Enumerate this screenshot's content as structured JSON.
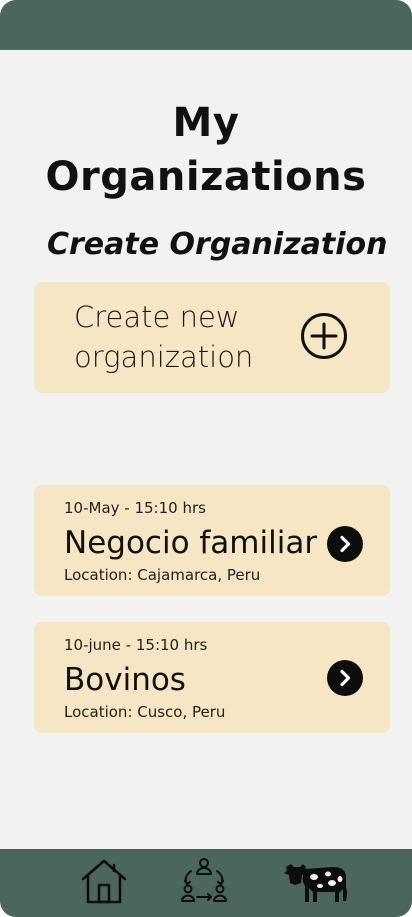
{
  "header": {
    "title_line1": "My",
    "title_line2": "Organizations"
  },
  "create_section": {
    "heading": "Create Organization",
    "card_label_line1": "Create new",
    "card_label_line2": "organization",
    "icon": "plus-circle-icon"
  },
  "organizations": [
    {
      "date": "10-May - 15:10 hrs",
      "name": "Negocio familiar",
      "location": "Location: Cajamarca, Peru",
      "icon": "chevron-right-circle-icon"
    },
    {
      "date": "10-june - 15:10 hrs",
      "name": "Bovinos",
      "location": "Location: Cusco, Peru",
      "icon": "chevron-right-circle-icon"
    }
  ],
  "bottom_nav": {
    "items": [
      {
        "icon": "home-icon"
      },
      {
        "icon": "organization-network-icon"
      },
      {
        "icon": "cow-icon"
      }
    ]
  },
  "colors": {
    "bar": "#4b665d",
    "card": "#f7e6c3",
    "background": "#f2f2f2",
    "text": "#111111"
  }
}
